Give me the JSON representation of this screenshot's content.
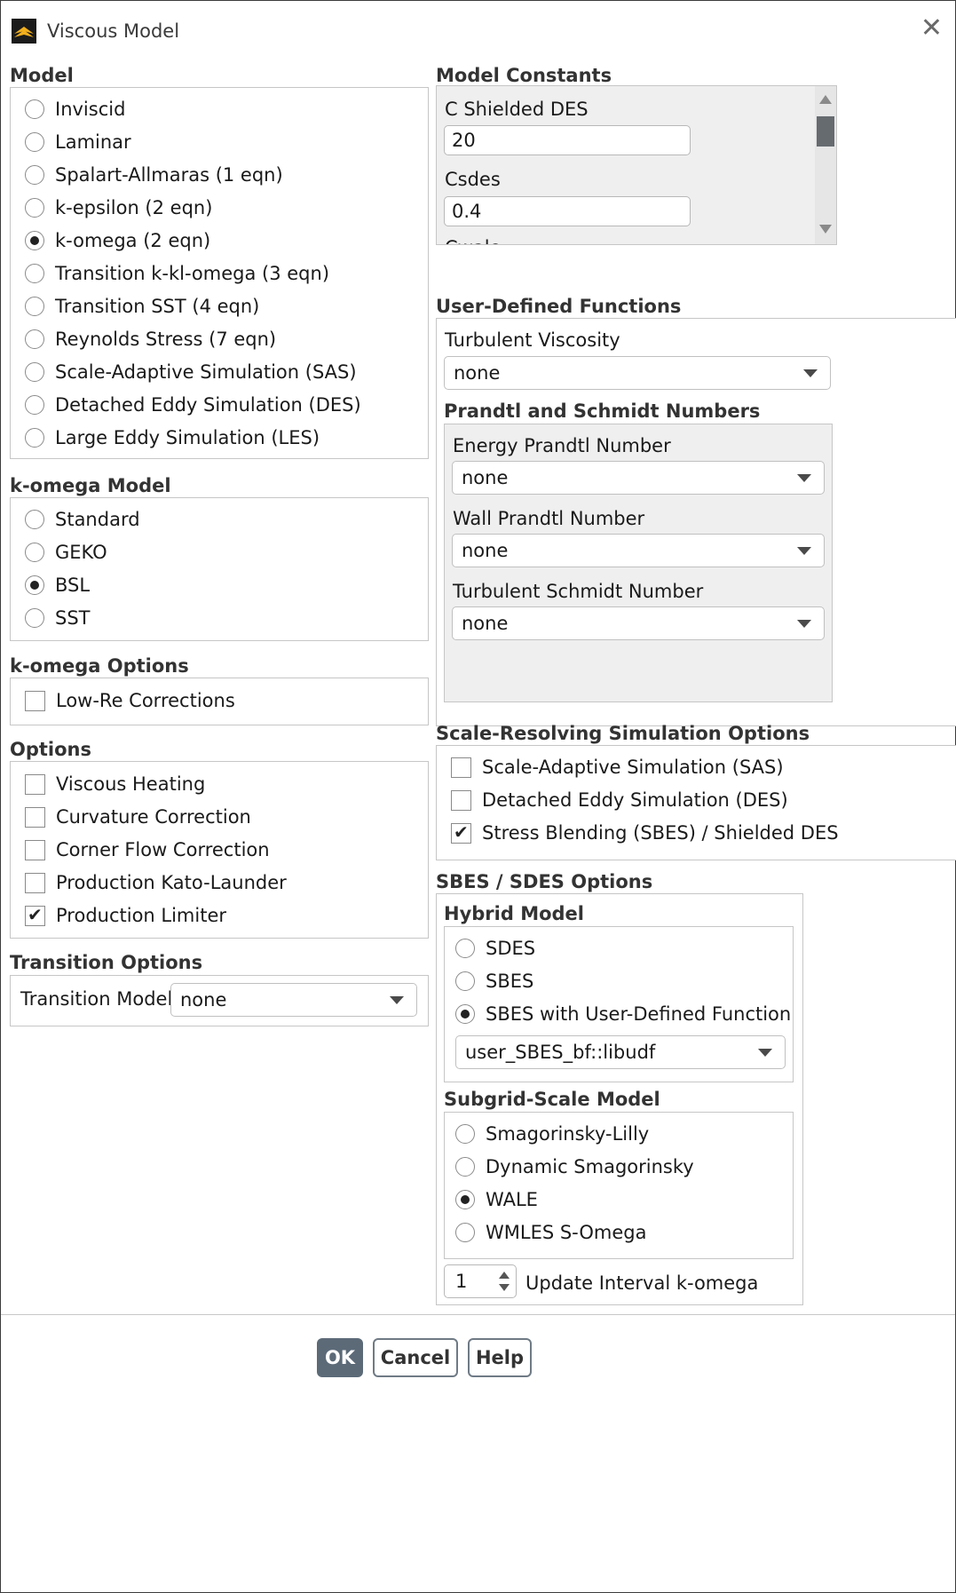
{
  "window": {
    "title": "Viscous Model",
    "icon": "fluent-app-icon",
    "close_icon": "close-icon"
  },
  "model": {
    "heading": "Model",
    "options": [
      {
        "label": "Inviscid",
        "selected": false
      },
      {
        "label": "Laminar",
        "selected": false
      },
      {
        "label": "Spalart-Allmaras (1 eqn)",
        "selected": false
      },
      {
        "label": "k-epsilon (2 eqn)",
        "selected": false
      },
      {
        "label": "k-omega (2 eqn)",
        "selected": true
      },
      {
        "label": "Transition k-kl-omega (3 eqn)",
        "selected": false
      },
      {
        "label": "Transition SST (4 eqn)",
        "selected": false
      },
      {
        "label": "Reynolds Stress (7 eqn)",
        "selected": false
      },
      {
        "label": "Scale-Adaptive Simulation (SAS)",
        "selected": false
      },
      {
        "label": "Detached Eddy Simulation (DES)",
        "selected": false
      },
      {
        "label": "Large Eddy Simulation (LES)",
        "selected": false
      }
    ]
  },
  "komega_model": {
    "heading": "k-omega Model",
    "options": [
      {
        "label": "Standard",
        "selected": false
      },
      {
        "label": "GEKO",
        "selected": false
      },
      {
        "label": "BSL",
        "selected": true
      },
      {
        "label": "SST",
        "selected": false
      }
    ]
  },
  "komega_options": {
    "heading": "k-omega Options",
    "items": [
      {
        "label": "Low-Re Corrections",
        "checked": false
      }
    ]
  },
  "options": {
    "heading": "Options",
    "items": [
      {
        "label": "Viscous Heating",
        "checked": false
      },
      {
        "label": "Curvature Correction",
        "checked": false
      },
      {
        "label": "Corner Flow Correction",
        "checked": false
      },
      {
        "label": "Production Kato-Launder",
        "checked": false
      },
      {
        "label": "Production Limiter",
        "checked": true
      }
    ]
  },
  "transition_options": {
    "heading": "Transition Options",
    "label": "Transition Model",
    "value": "none"
  },
  "model_constants": {
    "heading": "Model Constants",
    "constants": [
      {
        "label": "C Shielded DES",
        "value": "20"
      },
      {
        "label": "Csdes",
        "value": "0.4"
      }
    ],
    "partial_label": "Cwale"
  },
  "udf": {
    "heading": "User-Defined Functions",
    "turb_visc_label": "Turbulent Viscosity",
    "turb_visc_value": "none",
    "prandtl_heading": "Prandtl and Schmidt Numbers",
    "prandtl": [
      {
        "label": "Energy Prandtl Number",
        "value": "none"
      },
      {
        "label": "Wall Prandtl Number",
        "value": "none"
      },
      {
        "label": "Turbulent Schmidt Number",
        "value": "none"
      }
    ]
  },
  "srs_options": {
    "heading": "Scale-Resolving Simulation Options",
    "items": [
      {
        "label": "Scale-Adaptive Simulation (SAS)",
        "checked": false
      },
      {
        "label": "Detached Eddy Simulation (DES)",
        "checked": false
      },
      {
        "label": "Stress Blending (SBES) / Shielded DES",
        "checked": true
      }
    ]
  },
  "sbes": {
    "heading": "SBES / SDES Options",
    "hybrid_heading": "Hybrid Model",
    "hybrid_options": [
      {
        "label": "SDES",
        "selected": false
      },
      {
        "label": "SBES",
        "selected": false
      },
      {
        "label": "SBES with User-Defined Function",
        "selected": true
      }
    ],
    "udf_value": "user_SBES_bf::libudf",
    "subgrid_heading": "Subgrid-Scale Model",
    "subgrid_options": [
      {
        "label": "Smagorinsky-Lilly",
        "selected": false
      },
      {
        "label": "Dynamic Smagorinsky",
        "selected": false
      },
      {
        "label": "WALE",
        "selected": true
      },
      {
        "label": "WMLES S-Omega",
        "selected": false
      }
    ],
    "interval_value": "1",
    "interval_label": "Update Interval k-omega"
  },
  "buttons": {
    "ok": "OK",
    "cancel": "Cancel",
    "help": "Help"
  },
  "colors": {
    "primary_button": "#5c6a78",
    "border": "#c6c6c6",
    "panel_gray": "#efefef"
  }
}
